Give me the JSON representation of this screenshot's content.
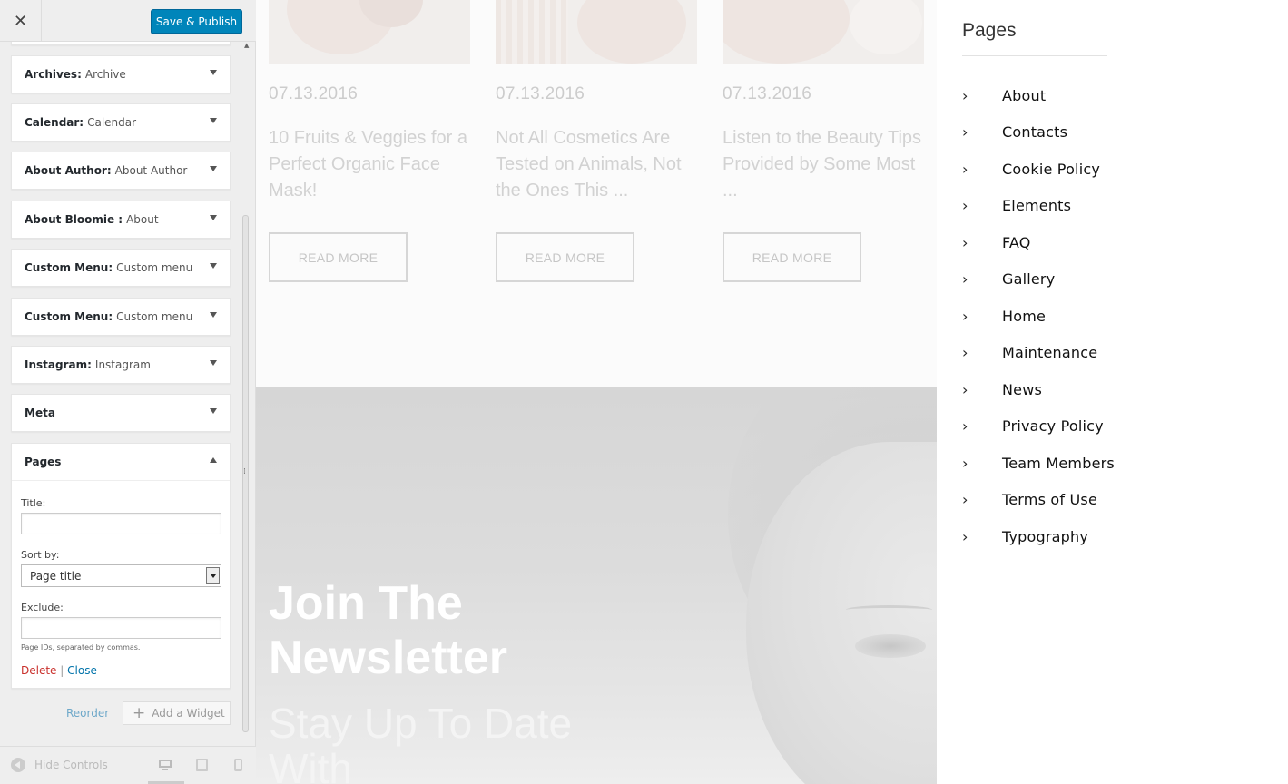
{
  "customizer": {
    "close_label": "✕",
    "save_label": "Save & Publish",
    "widgets": [
      {
        "type": "Archives:",
        "title": "Archive"
      },
      {
        "type": "Calendar:",
        "title": "Calendar"
      },
      {
        "type": "About Author:",
        "title": "About Author"
      },
      {
        "type": "About Bloomie :",
        "title": "About"
      },
      {
        "type": "Custom Menu:",
        "title": "Custom menu"
      },
      {
        "type": "Custom Menu:",
        "title": "Custom menu"
      },
      {
        "type": "Instagram:",
        "title": "Instagram"
      },
      {
        "type": "Meta",
        "title": ""
      },
      {
        "type": "Pages",
        "title": ""
      }
    ],
    "pages_form": {
      "title_label": "Title:",
      "title_value": "",
      "sort_label": "Sort by:",
      "sort_value": "Page title",
      "exclude_label": "Exclude:",
      "exclude_value": "",
      "exclude_hint": "Page IDs, separated by commas.",
      "delete_label": "Delete",
      "separator": "|",
      "close_label": "Close"
    },
    "reorder_label": "Reorder",
    "add_widget_label": "Add a Widget",
    "hide_controls_label": "Hide Controls"
  },
  "preview": {
    "posts": [
      {
        "date": "07.13.2016",
        "title": "10 Fruits & Veggies for a Perfect Organic Face Mask!",
        "button": "READ MORE"
      },
      {
        "date": "07.13.2016",
        "title": "Not All Cosmetics Are Tested on Animals, Not the Ones This ...",
        "button": "READ MORE"
      },
      {
        "date": "07.13.2016",
        "title": "Listen to the Beauty Tips Provided by Some Most ...",
        "button": "READ MORE"
      }
    ],
    "newsletter": {
      "title": "Join The Newsletter",
      "subtitle": "Stay Up To Date With"
    }
  },
  "pages_widget": {
    "heading": "Pages",
    "chevron": "›",
    "items": [
      "About",
      "Contacts",
      "Cookie Policy",
      "Elements",
      "FAQ",
      "Gallery",
      "Home",
      "Maintenance",
      "News",
      "Privacy Policy",
      "Team Members",
      "Terms of Use",
      "Typography"
    ]
  },
  "colors": {
    "accent": "#0085ba",
    "delete": "#c9302c",
    "link": "#0073aa"
  }
}
